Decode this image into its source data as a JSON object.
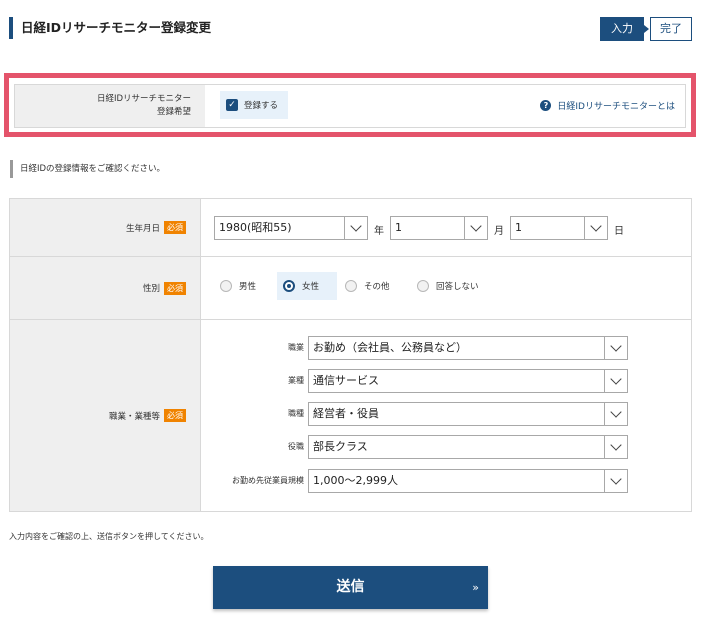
{
  "header": {
    "title": "日経IDリサーチモニター登録変更",
    "steps": [
      {
        "label": "入力",
        "active": true
      },
      {
        "label": "完了",
        "active": false
      }
    ]
  },
  "monitor": {
    "label_line1": "日経IDリサーチモニター",
    "label_line2": "登録希望",
    "checkbox_label": "登録する",
    "checked": true,
    "help_link": "日経IDリサーチモニターとは"
  },
  "section_note": "日経IDの登録情報をご確認ください。",
  "form": {
    "required_badge": "必須",
    "birthdate": {
      "label": "生年月日",
      "year_value": "1980(昭和55)",
      "year_unit": "年",
      "month_value": "1",
      "month_unit": "月",
      "day_value": "1",
      "day_unit": "日"
    },
    "gender": {
      "label": "性別",
      "options": [
        "男性",
        "女性",
        "その他",
        "回答しない"
      ],
      "selected": "女性"
    },
    "occupation": {
      "label": "職業・業種等",
      "fields": [
        {
          "label": "職業",
          "value": "お勤め（会社員、公務員など）"
        },
        {
          "label": "業種",
          "value": "通信サービス"
        },
        {
          "label": "職種",
          "value": "経営者・役員"
        },
        {
          "label": "役職",
          "value": "部長クラス"
        },
        {
          "label": "お勤め先従業員規模",
          "value": "1,000〜2,999人"
        }
      ]
    }
  },
  "instructions": "入力内容をご確認の上、送信ボタンを押してください。",
  "submit": {
    "label": "送信",
    "chevron": "»"
  },
  "colors": {
    "primary": "#1c4e7e",
    "highlight_border": "#e4546b",
    "required": "#f08300",
    "label_bg": "#efefef",
    "selected_bg": "#e7f1fa"
  }
}
